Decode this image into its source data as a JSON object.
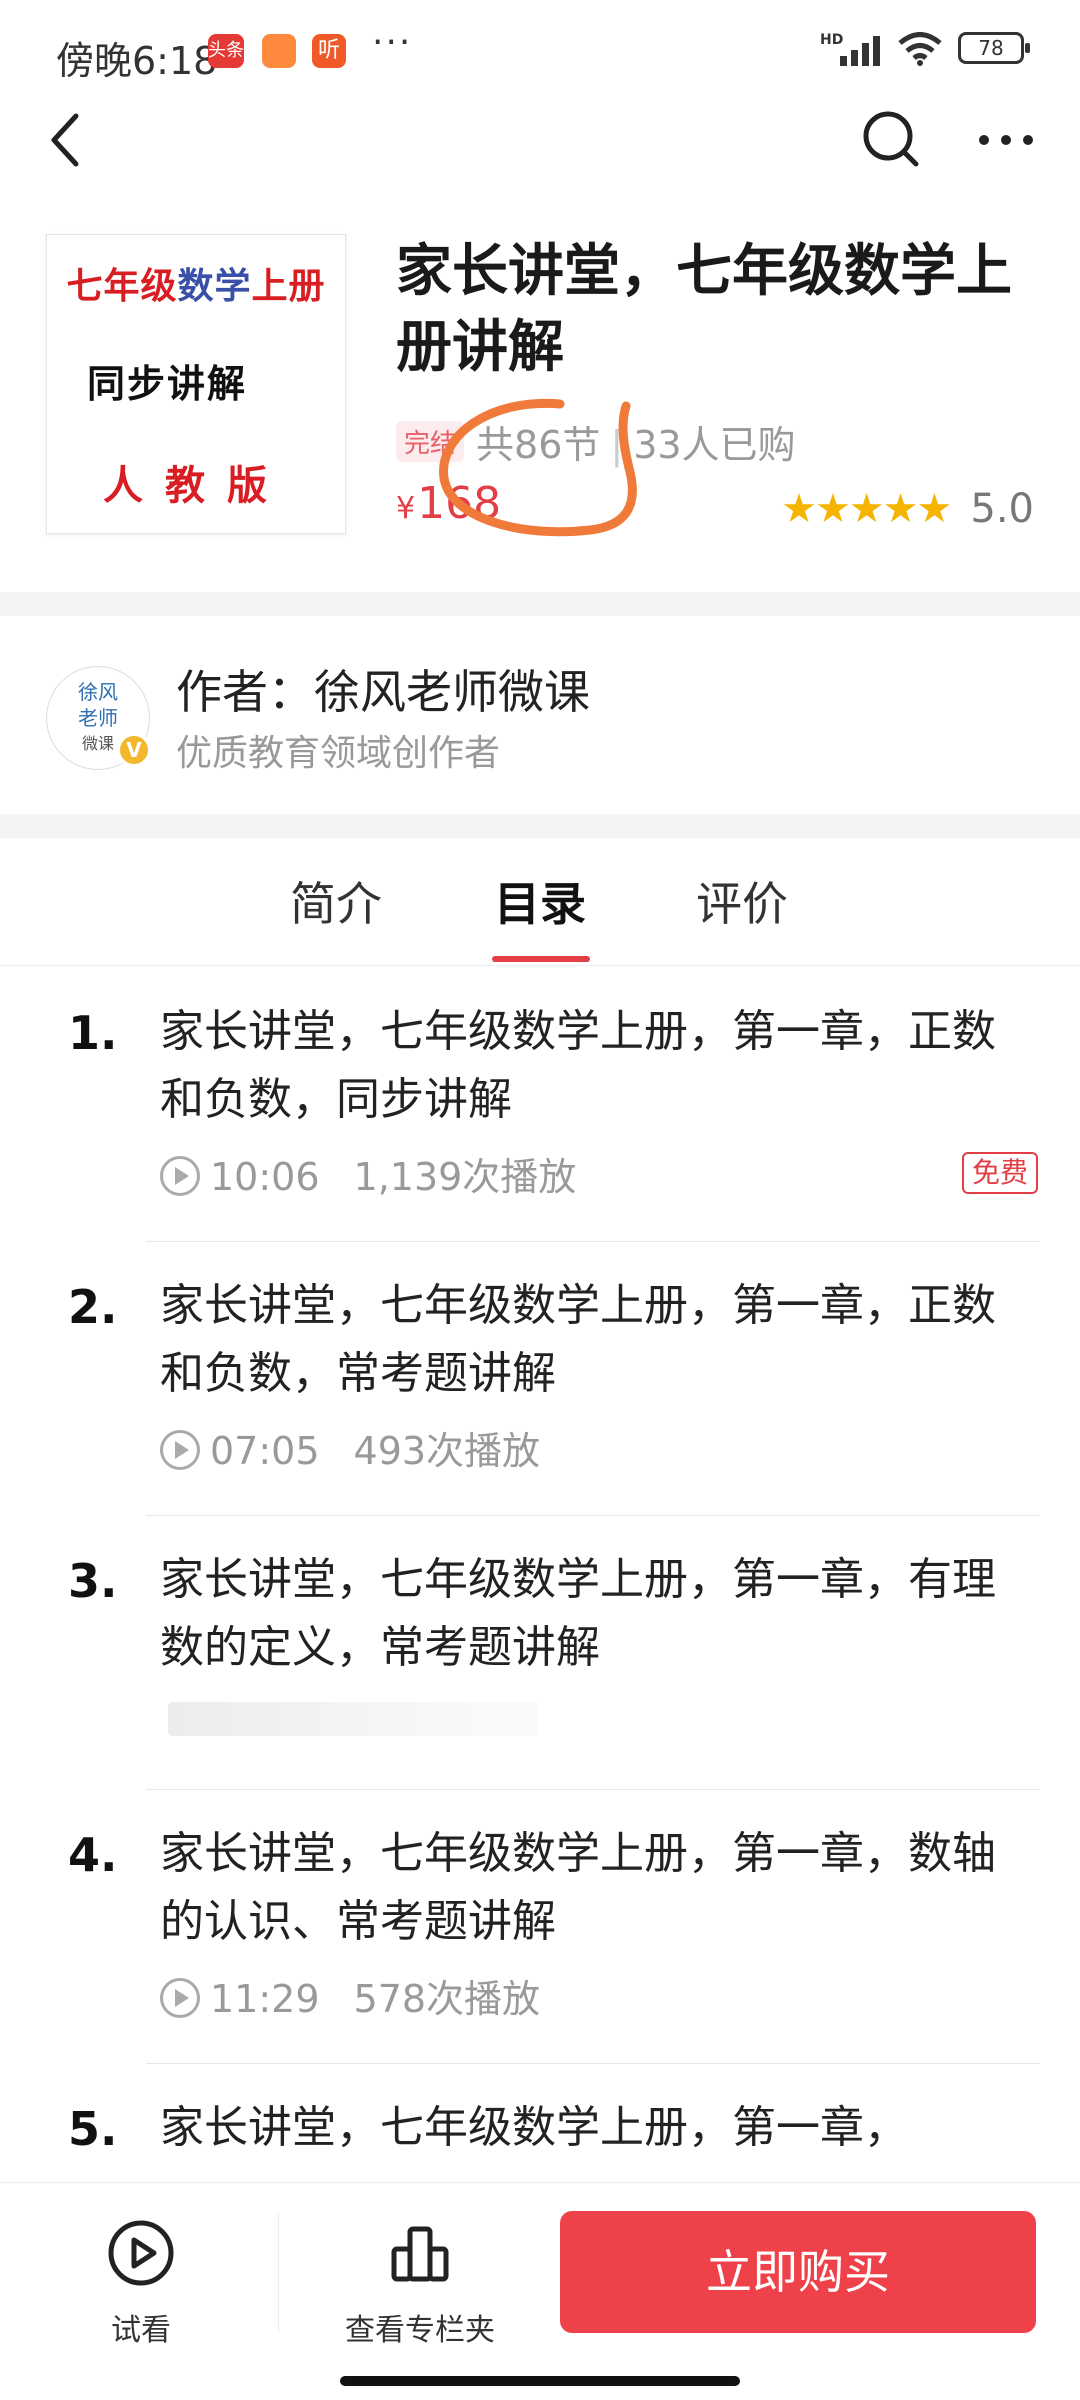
{
  "status_bar": {
    "time": "傍晚6:18",
    "app_icon_1": "头条",
    "app_icon_2": "",
    "app_icon_3": "听",
    "more": "···",
    "network": "HD",
    "battery": "78"
  },
  "nav": {
    "back_icon": "chevron-left-icon",
    "search_icon": "search-icon",
    "more_icon": "more-icon"
  },
  "product": {
    "cover_line1_a": "七年级",
    "cover_line1_b": "数学",
    "cover_line1_c": "上册",
    "cover_line2": "同步讲解",
    "cover_line3": "人教版",
    "title": "家长讲堂，七年级数学上册讲解",
    "status_tag": "完结",
    "lessons": "共86节",
    "buyers": "33人已购",
    "price_symbol": "¥",
    "price": "168",
    "stars": "★★★★★",
    "rating": "5.0",
    "annotation_color": "#f07a3a"
  },
  "author": {
    "avatar_text_1": "徐风",
    "avatar_text_2": "老师",
    "avatar_text_3": "微课",
    "badge": "V",
    "name": "作者：徐风老师微课",
    "description": "优质教育领域创作者"
  },
  "tabs": [
    {
      "label": "简介",
      "active": false
    },
    {
      "label": "目录",
      "active": true
    },
    {
      "label": "评价",
      "active": false
    }
  ],
  "lessons": [
    {
      "num": "1.",
      "title": "家长讲堂，七年级数学上册，第一章，正数和负数，同步讲解",
      "duration": "10:06",
      "plays": "1,139次播放",
      "badge": "免费"
    },
    {
      "num": "2.",
      "title": "家长讲堂，七年级数学上册，第一章，正数和负数，常考题讲解",
      "duration": "07:05",
      "plays": "493次播放",
      "badge": ""
    },
    {
      "num": "3.",
      "title": "家长讲堂，七年级数学上册，第一章，有理数的定义，常考题讲解",
      "duration": "",
      "plays": "",
      "badge": ""
    },
    {
      "num": "4.",
      "title": "家长讲堂，七年级数学上册，第一章，数轴的认识、常考题讲解",
      "duration": "11:29",
      "plays": "578次播放",
      "badge": ""
    },
    {
      "num": "5.",
      "title": "家长讲堂，七年级数学上册，第一章，",
      "duration": "",
      "plays": "",
      "badge": ""
    }
  ],
  "bottom_bar": {
    "trial_label": "试看",
    "trial_icon": "play-circle-icon",
    "folder_label": "查看专栏夹",
    "folder_icon": "columns-icon",
    "buy_label": "立即购买",
    "accent": "#ef4149"
  }
}
